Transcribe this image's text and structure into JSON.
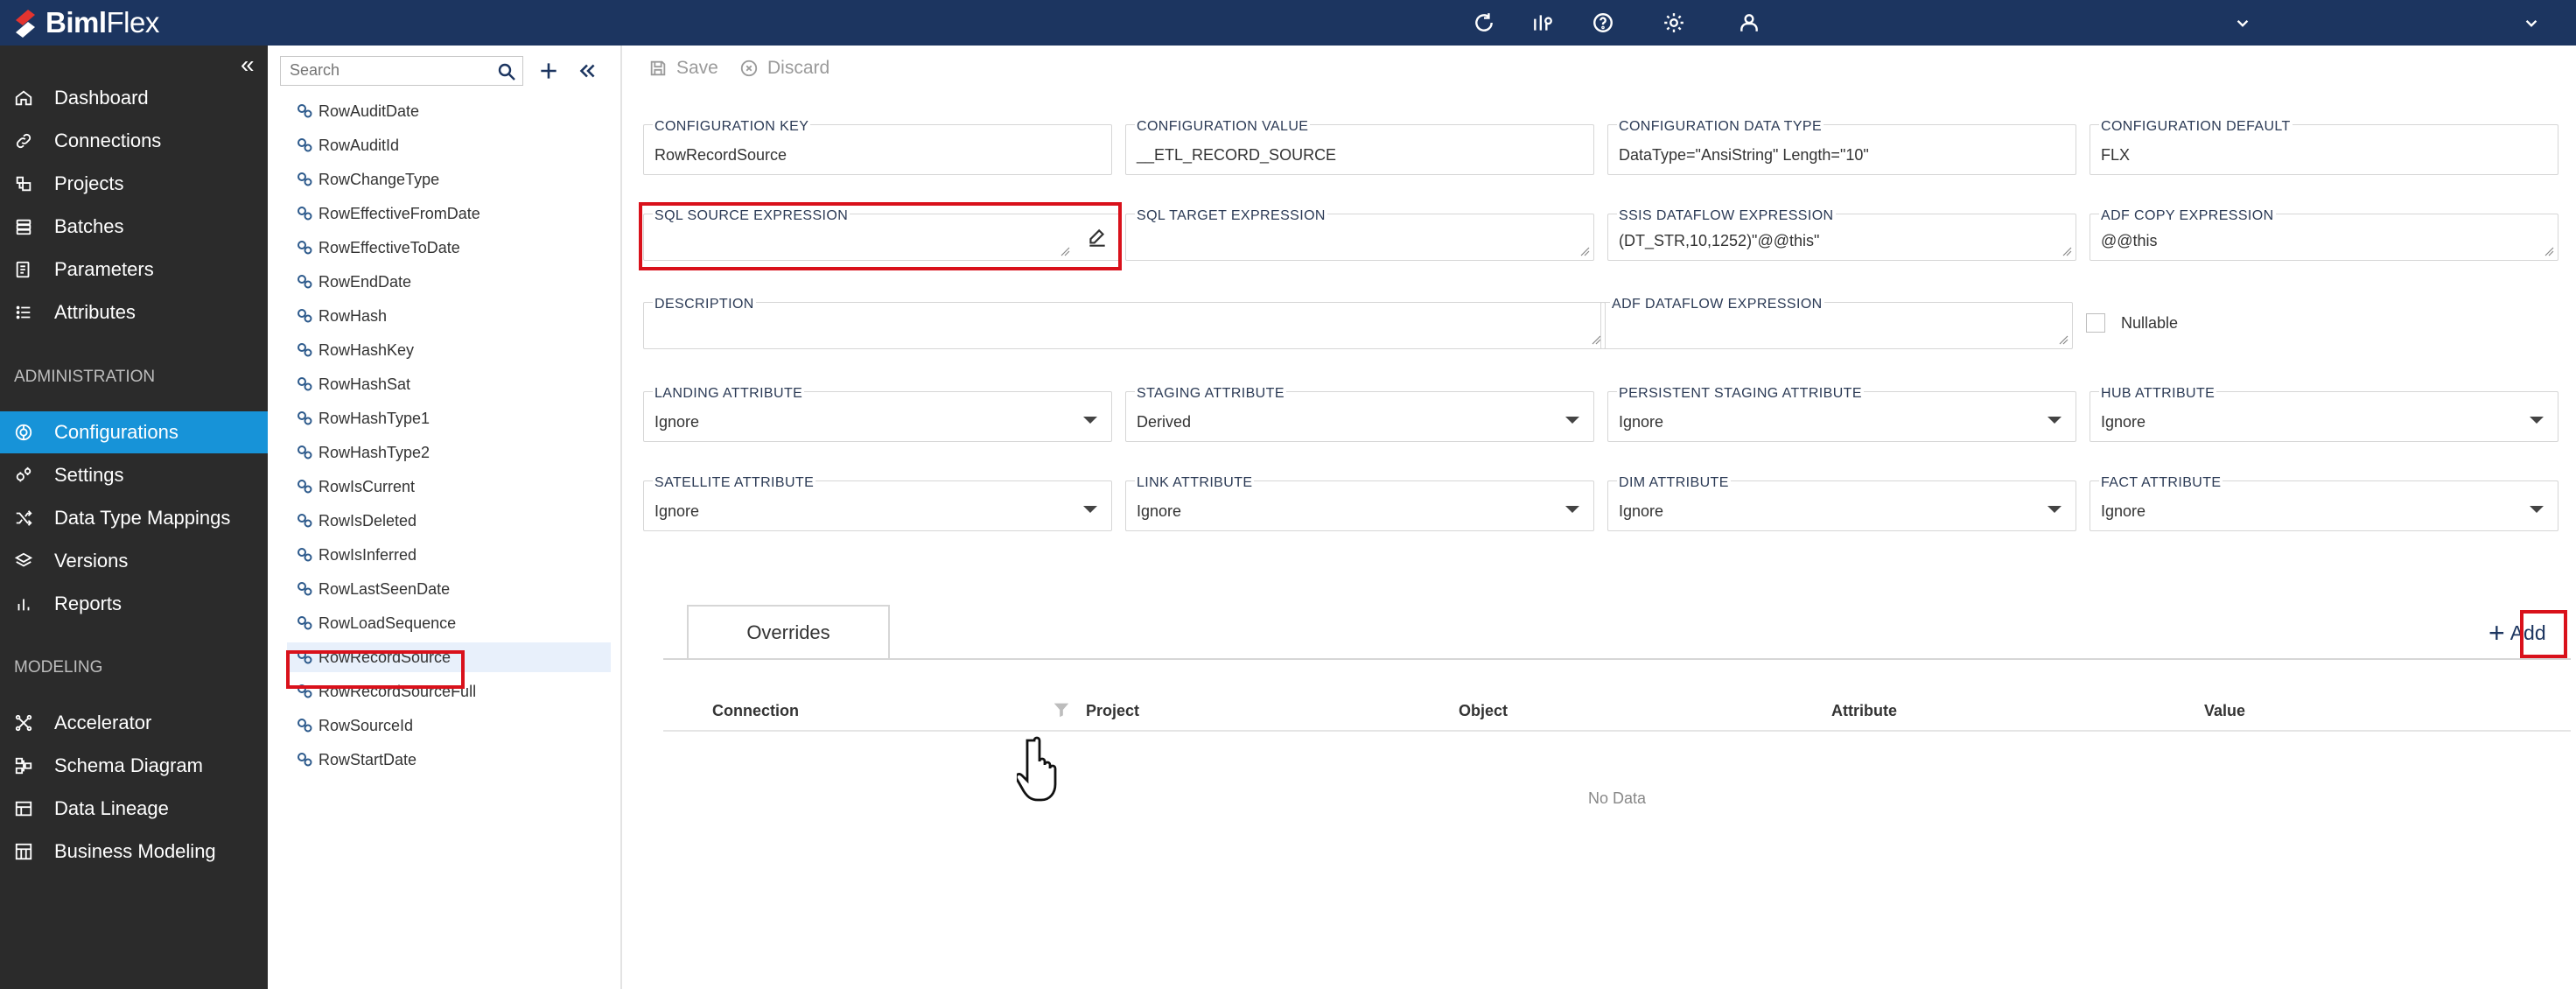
{
  "app": {
    "logo_bold": "Biml",
    "logo_light": "Flex"
  },
  "sidebar": {
    "items": [
      {
        "label": "Dashboard",
        "icon": "home-icon"
      },
      {
        "label": "Connections",
        "icon": "link-icon"
      },
      {
        "label": "Projects",
        "icon": "projects-icon"
      },
      {
        "label": "Batches",
        "icon": "stack-icon"
      },
      {
        "label": "Parameters",
        "icon": "parameters-icon"
      },
      {
        "label": "Attributes",
        "icon": "list-icon"
      }
    ],
    "section_admin": "ADMINISTRATION",
    "admin_items": [
      {
        "label": "Configurations",
        "icon": "configurations-icon"
      },
      {
        "label": "Settings",
        "icon": "settings-icon"
      },
      {
        "label": "Data Type Mappings",
        "icon": "shuffle-icon"
      },
      {
        "label": "Versions",
        "icon": "layers-icon"
      },
      {
        "label": "Reports",
        "icon": "bar-chart-icon"
      }
    ],
    "section_modeling": "MODELING",
    "modeling_items": [
      {
        "label": "Accelerator",
        "icon": "accelerator-icon"
      },
      {
        "label": "Schema Diagram",
        "icon": "schema-icon"
      },
      {
        "label": "Data Lineage",
        "icon": "lineage-icon"
      },
      {
        "label": "Business Modeling",
        "icon": "business-icon"
      }
    ]
  },
  "tree": {
    "search_placeholder": "Search",
    "items": [
      "RowAuditDate",
      "RowAuditId",
      "RowChangeType",
      "RowEffectiveFromDate",
      "RowEffectiveToDate",
      "RowEndDate",
      "RowHash",
      "RowHashKey",
      "RowHashSat",
      "RowHashType1",
      "RowHashType2",
      "RowIsCurrent",
      "RowIsDeleted",
      "RowIsInferred",
      "RowLastSeenDate",
      "RowLoadSequence",
      "RowRecordSource",
      "RowRecordSourceFull",
      "RowSourceId",
      "RowStartDate"
    ],
    "selected": "RowRecordSource"
  },
  "toolbar": {
    "save": "Save",
    "discard": "Discard"
  },
  "form": {
    "config_key": {
      "label": "CONFIGURATION KEY",
      "value": "RowRecordSource"
    },
    "config_value": {
      "label": "CONFIGURATION VALUE",
      "value": "__ETL_RECORD_SOURCE"
    },
    "config_data_type": {
      "label": "CONFIGURATION DATA TYPE",
      "value": "DataType=\"AnsiString\" Length=\"10\""
    },
    "config_default": {
      "label": "CONFIGURATION DEFAULT",
      "value": "FLX"
    },
    "sql_source": {
      "label": "SQL SOURCE EXPRESSION",
      "value": ""
    },
    "sql_target": {
      "label": "SQL TARGET EXPRESSION",
      "value": ""
    },
    "ssis_dataflow": {
      "label": "SSIS DATAFLOW EXPRESSION",
      "value": "(DT_STR,10,1252)\"@@this\""
    },
    "adf_copy": {
      "label": "ADF COPY EXPRESSION",
      "value": "@@this"
    },
    "description": {
      "label": "DESCRIPTION",
      "value": ""
    },
    "adf_dataflow": {
      "label": "ADF DATAFLOW EXPRESSION",
      "value": ""
    },
    "nullable": {
      "label": "Nullable",
      "checked": false
    },
    "landing": {
      "label": "LANDING ATTRIBUTE",
      "value": "Ignore"
    },
    "staging": {
      "label": "STAGING ATTRIBUTE",
      "value": "Derived"
    },
    "persistent_staging": {
      "label": "PERSISTENT STAGING ATTRIBUTE",
      "value": "Ignore"
    },
    "hub": {
      "label": "HUB ATTRIBUTE",
      "value": "Ignore"
    },
    "satellite": {
      "label": "SATELLITE ATTRIBUTE",
      "value": "Ignore"
    },
    "link": {
      "label": "LINK ATTRIBUTE",
      "value": "Ignore"
    },
    "dim": {
      "label": "DIM ATTRIBUTE",
      "value": "Ignore"
    },
    "fact": {
      "label": "FACT ATTRIBUTE",
      "value": "Ignore"
    }
  },
  "overrides": {
    "tab": "Overrides",
    "add": "Add",
    "columns": [
      "Connection",
      "Project",
      "Object",
      "Attribute",
      "Value"
    ],
    "empty": "No Data"
  },
  "colors": {
    "topbar": "#1c3560",
    "sidebar": "#2b2b2b",
    "active": "#1793d8",
    "highlight": "#d9111b"
  }
}
